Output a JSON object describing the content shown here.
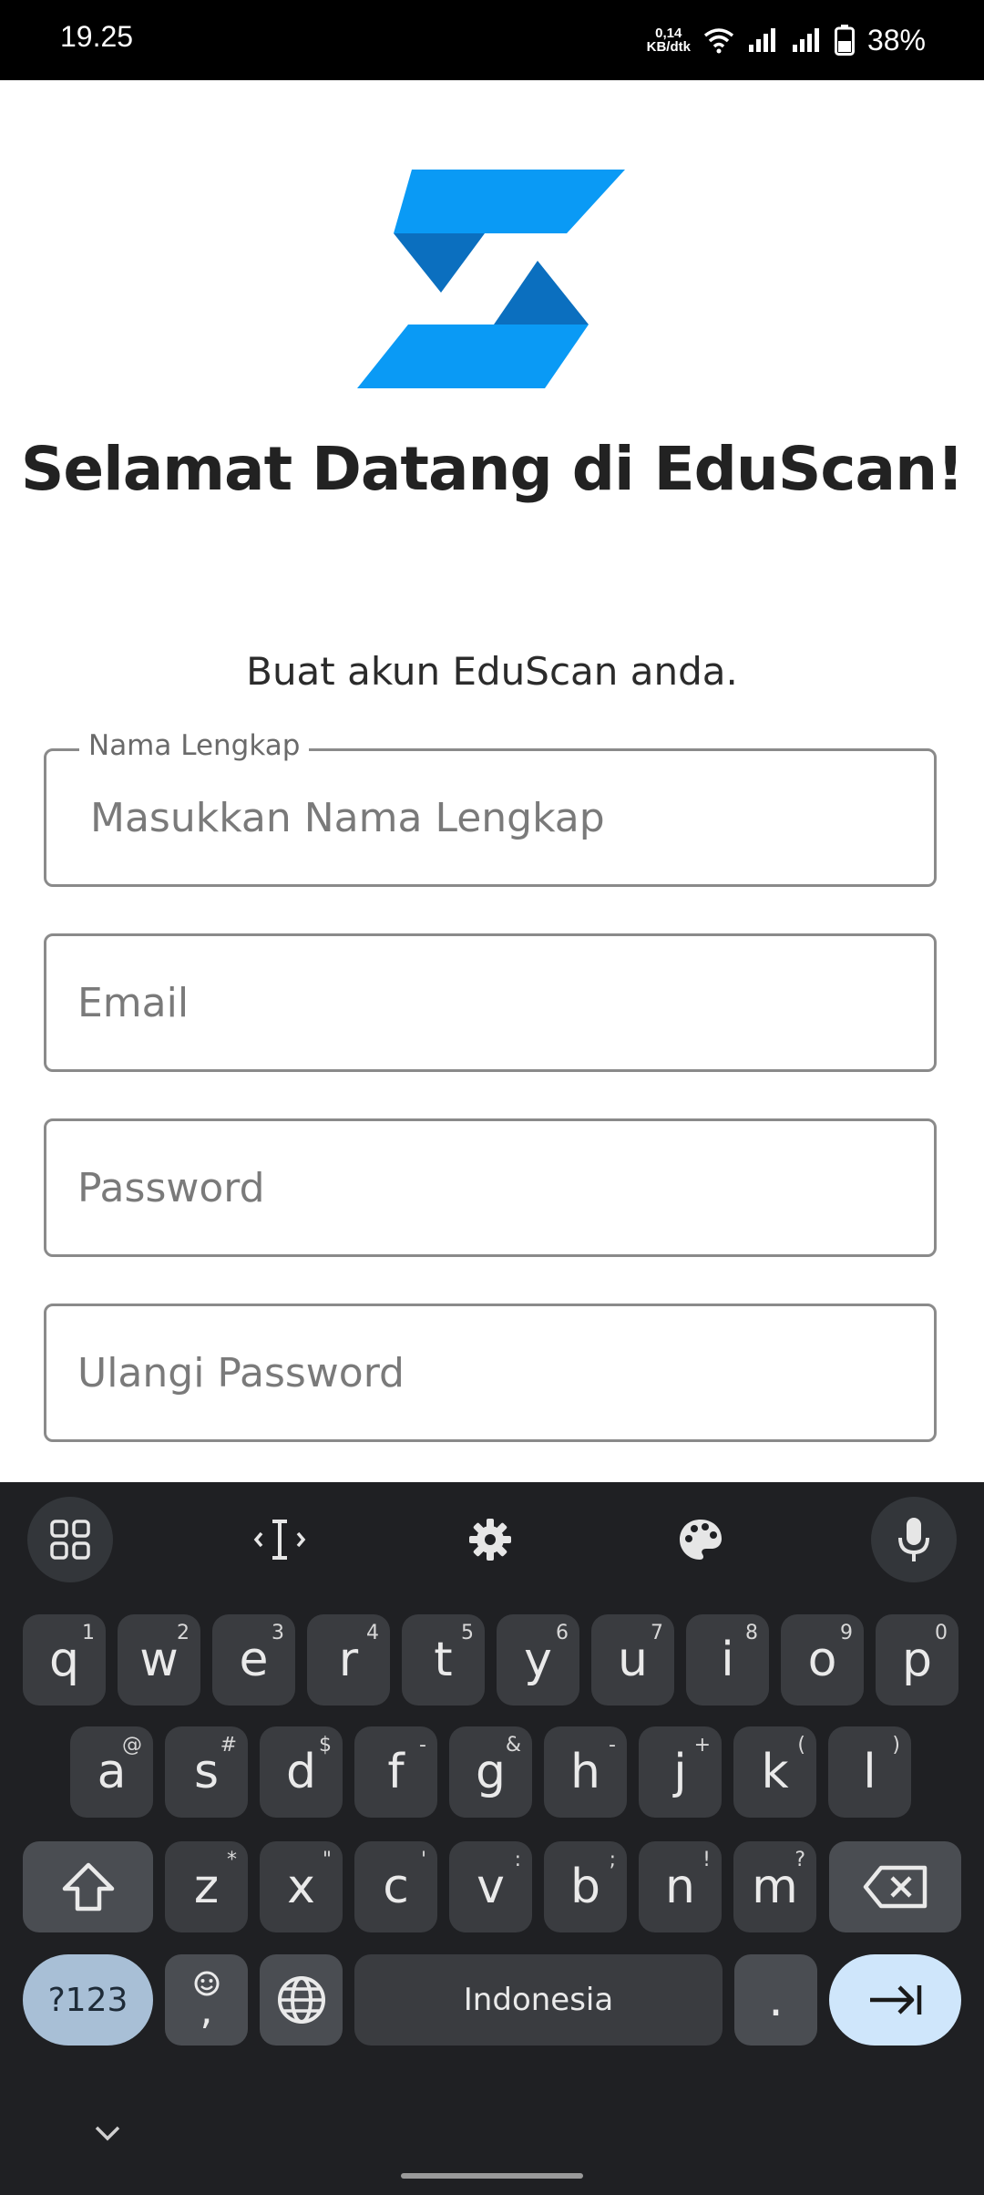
{
  "status_bar": {
    "time": "19.25",
    "net_speed_value": "0,14",
    "net_speed_unit": "KB/dtk",
    "battery_percent": "38%",
    "icons": [
      "wifi-icon",
      "signal-icon",
      "signal-icon",
      "battery-icon"
    ]
  },
  "app": {
    "title": "Selamat Datang di EduScan!",
    "subtitle": "Buat akun EduScan anda.",
    "colors": {
      "logo_light": "#0a9af5",
      "logo_dark": "#0b6fbf"
    },
    "fields": {
      "name": {
        "label": "Nama Lengkap",
        "placeholder": "Masukkan Nama Lengkap",
        "value": ""
      },
      "email": {
        "placeholder": "Email",
        "value": ""
      },
      "password": {
        "placeholder": "Password",
        "value": ""
      },
      "repeat_password": {
        "placeholder": "Ulangi Password",
        "value": ""
      }
    }
  },
  "keyboard": {
    "toolbar_icons": [
      "apps-grid-icon",
      "text-cursor-icon",
      "gear-icon",
      "palette-icon",
      "microphone-icon"
    ],
    "row1": [
      {
        "k": "q",
        "h": "1"
      },
      {
        "k": "w",
        "h": "2"
      },
      {
        "k": "e",
        "h": "3"
      },
      {
        "k": "r",
        "h": "4"
      },
      {
        "k": "t",
        "h": "5"
      },
      {
        "k": "y",
        "h": "6"
      },
      {
        "k": "u",
        "h": "7"
      },
      {
        "k": "i",
        "h": "8"
      },
      {
        "k": "o",
        "h": "9"
      },
      {
        "k": "p",
        "h": "0"
      }
    ],
    "row2": [
      {
        "k": "a",
        "h": "@"
      },
      {
        "k": "s",
        "h": "#"
      },
      {
        "k": "d",
        "h": "$"
      },
      {
        "k": "f",
        "h": "-"
      },
      {
        "k": "g",
        "h": "&"
      },
      {
        "k": "h",
        "h": "-"
      },
      {
        "k": "j",
        "h": "+"
      },
      {
        "k": "k",
        "h": "("
      },
      {
        "k": "l",
        "h": ")"
      }
    ],
    "row3": [
      {
        "k": "z",
        "h": "*"
      },
      {
        "k": "x",
        "h": "\""
      },
      {
        "k": "c",
        "h": "'"
      },
      {
        "k": "v",
        "h": ":"
      },
      {
        "k": "b",
        "h": ";"
      },
      {
        "k": "n",
        "h": "!"
      },
      {
        "k": "m",
        "h": "?"
      }
    ],
    "sym_label": "?123",
    "emoji_comma": ",",
    "space_label": "Indonesia",
    "period": "."
  }
}
